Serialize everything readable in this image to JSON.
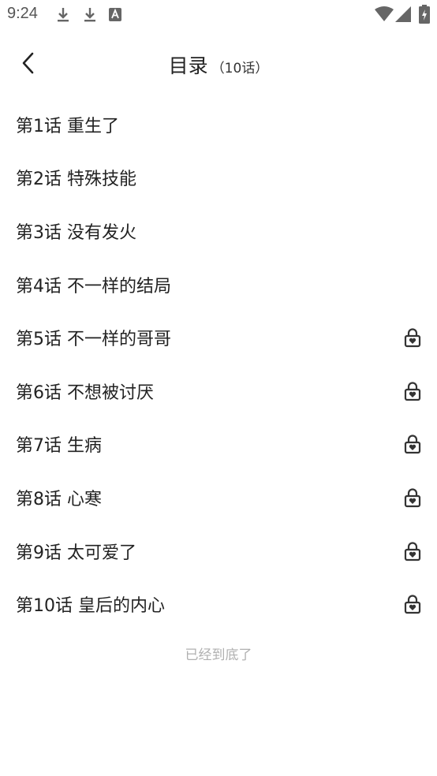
{
  "status_bar": {
    "time": "9:24",
    "notification_icons": [
      "download-icon",
      "download-icon",
      "text-a-icon"
    ],
    "system_icons": [
      "wifi-icon",
      "signal-icon",
      "battery-icon"
    ]
  },
  "header": {
    "title": "目录",
    "count": "（10话）",
    "back_icon": "chevron-left-icon"
  },
  "chapters": [
    {
      "label": "第1话 重生了",
      "locked": false
    },
    {
      "label": "第2话 特殊技能",
      "locked": false
    },
    {
      "label": "第3话 没有发火",
      "locked": false
    },
    {
      "label": "第4话 不一样的结局",
      "locked": false
    },
    {
      "label": "第5话 不一样的哥哥",
      "locked": true
    },
    {
      "label": "第6话 不想被讨厌",
      "locked": true
    },
    {
      "label": "第7话 生病",
      "locked": true
    },
    {
      "label": "第8话 心寒",
      "locked": true
    },
    {
      "label": "第9话 太可爱了",
      "locked": true
    },
    {
      "label": "第10话 皇后的内心",
      "locked": true
    }
  ],
  "footer": {
    "end_text": "已经到底了"
  },
  "colors": {
    "text": "#222222",
    "muted": "#b0b0b0",
    "icon": "#333333"
  }
}
